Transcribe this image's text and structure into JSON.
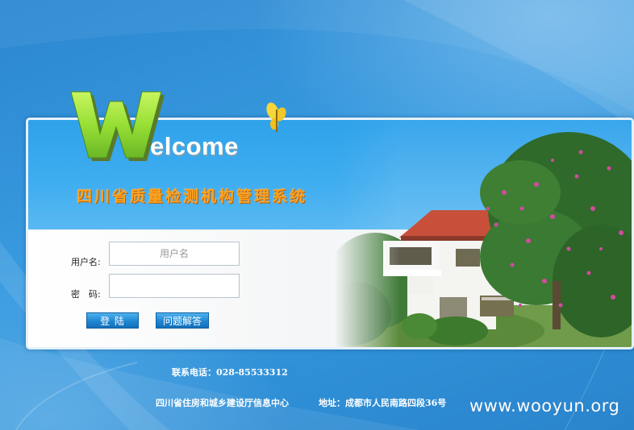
{
  "branding": {
    "welcome_initial": "W",
    "welcome_rest": "elcome",
    "system_title": "四川省质量检测机构管理系统"
  },
  "login": {
    "username_label": "用户名:",
    "username_placeholder": "用户名",
    "username_value": "",
    "password_label": "密　码:",
    "password_value": "",
    "login_button": "登 陆",
    "help_button": "问题解答"
  },
  "footer": {
    "phone": "联系电话：028-85533312",
    "organization": "四川省住房和城乡建设厅信息中心",
    "address": "地址：成都市人民南路四段36号"
  },
  "watermark": "www.wooyun.org",
  "colors": {
    "page_background": "#2f8fd6",
    "banner_blue": "#40aef0",
    "title_orange": "#ffa21f",
    "logo_green": "#9be03a",
    "button_blue": "#1f86d2"
  }
}
